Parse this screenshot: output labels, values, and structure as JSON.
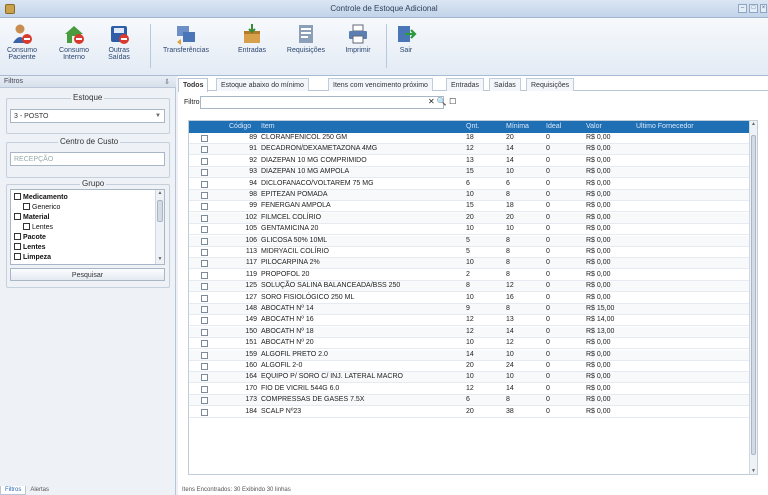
{
  "window": {
    "title": "Controle de Estoque Adicional"
  },
  "ribbon": {
    "buttons": [
      {
        "label": "Consumo\nPaciente",
        "icon": "patient-consumption-icon"
      },
      {
        "label": "Consumo\nInterno",
        "icon": "home-consumption-icon"
      },
      {
        "label": "Outras\nSaídas",
        "icon": "other-exits-icon"
      },
      {
        "label": "Transferências",
        "icon": "transfer-icon"
      },
      {
        "label": "Entradas",
        "icon": "entries-icon"
      },
      {
        "label": "Requisições",
        "icon": "requisitions-icon"
      },
      {
        "label": "Imprimir",
        "icon": "printer-icon"
      },
      {
        "label": "Sair",
        "icon": "exit-icon"
      }
    ]
  },
  "sidebar": {
    "header": "Filtros",
    "estoque": {
      "label": "Estoque",
      "value": "3 - POSTO"
    },
    "centro_custo": {
      "label": "Centro de Custo",
      "placeholder": "RECEPÇÃO"
    },
    "grupo": {
      "label": "Grupo",
      "items": [
        {
          "label": "Medicamento",
          "level": 0
        },
        {
          "label": "Generico",
          "level": 1
        },
        {
          "label": "Material",
          "level": 0
        },
        {
          "label": "Lentes",
          "level": 1
        },
        {
          "label": "Pacote",
          "level": 0
        },
        {
          "label": "Lentes",
          "level": 0
        },
        {
          "label": "Limpeza",
          "level": 0
        }
      ]
    },
    "search_button": "Pesquisar",
    "bottom_tabs": [
      "Filtros",
      "Alertas"
    ]
  },
  "main": {
    "tabs": [
      "Todos",
      "Estoque abaixo do mínimo",
      "Itens com vencimento próximo",
      "Entradas",
      "Saídas",
      "Requisições"
    ],
    "filter_label": "Filtro:",
    "filter_tools": "✕ 🔍 ☐",
    "columns": [
      "Código",
      "Item",
      "Qnt.",
      "Mínima",
      "Ideal",
      "Valor",
      "Ultimo Fornecedor"
    ],
    "rows": [
      [
        "89",
        "CLORANFENICOL 250 GM",
        "18",
        "20",
        "0",
        "R$ 0,00",
        ""
      ],
      [
        "91",
        "DECADRON/DEXAMETAZONA 4MG",
        "12",
        "14",
        "0",
        "R$ 0,00",
        ""
      ],
      [
        "92",
        "DIAZEPAN 10 MG COMPRIMIDO",
        "13",
        "14",
        "0",
        "R$ 0,00",
        ""
      ],
      [
        "93",
        "DIAZEPAN 10 MG AMPOLA",
        "15",
        "10",
        "0",
        "R$ 0,00",
        ""
      ],
      [
        "94",
        "DICLOFANACO/VOLTAREM 75 MG",
        "6",
        "6",
        "0",
        "R$ 0,00",
        ""
      ],
      [
        "98",
        "EPITEZAN POMADA",
        "10",
        "8",
        "0",
        "R$ 0,00",
        ""
      ],
      [
        "99",
        "FENERGAN AMPOLA",
        "15",
        "18",
        "0",
        "R$ 0,00",
        ""
      ],
      [
        "102",
        "FILMCEL COLÍRIO",
        "20",
        "20",
        "0",
        "R$ 0,00",
        ""
      ],
      [
        "105",
        "GENTAMICINA 20",
        "10",
        "10",
        "0",
        "R$ 0,00",
        ""
      ],
      [
        "106",
        "GLICOSA 50% 10ML",
        "5",
        "8",
        "0",
        "R$ 0,00",
        ""
      ],
      [
        "113",
        "MIDRYACIL COLÍRIO",
        "5",
        "8",
        "0",
        "R$ 0,00",
        ""
      ],
      [
        "117",
        "PILOCARPINA 2%",
        "10",
        "8",
        "0",
        "R$ 0,00",
        ""
      ],
      [
        "119",
        "PROPOFOL 20",
        "2",
        "8",
        "0",
        "R$ 0,00",
        ""
      ],
      [
        "125",
        "SOLUÇÃO SALINA BALANCEADA/BSS 250",
        "8",
        "12",
        "0",
        "R$ 0,00",
        ""
      ],
      [
        "127",
        "SORO FISIOLÓGICO 250 ML",
        "10",
        "16",
        "0",
        "R$ 0,00",
        ""
      ],
      [
        "148",
        "ABOCATH Nº 14",
        "9",
        "8",
        "0",
        "R$ 15,00",
        ""
      ],
      [
        "149",
        "ABOCATH Nº 16",
        "12",
        "13",
        "0",
        "R$ 14,00",
        ""
      ],
      [
        "150",
        "ABOCATH Nº 18",
        "12",
        "14",
        "0",
        "R$ 13,00",
        ""
      ],
      [
        "151",
        "ABOCATH Nº 20",
        "10",
        "12",
        "0",
        "R$ 0,00",
        ""
      ],
      [
        "159",
        "ALGOFIL PRETO 2.0",
        "14",
        "10",
        "0",
        "R$ 0,00",
        ""
      ],
      [
        "160",
        "ALGOFIL 2-0",
        "20",
        "24",
        "0",
        "R$ 0,00",
        ""
      ],
      [
        "164",
        "EQUIPO P/ SORO C/ INJ. LATERAL MACRO",
        "10",
        "10",
        "0",
        "R$ 0,00",
        ""
      ],
      [
        "170",
        "FIO DE VICRIL 544G 6.0",
        "12",
        "14",
        "0",
        "R$ 0,00",
        ""
      ],
      [
        "173",
        "COMPRESSAS DE GASES 7.5X",
        "6",
        "8",
        "0",
        "R$ 0,00",
        ""
      ],
      [
        "184",
        "SCALP Nº23",
        "20",
        "38",
        "0",
        "R$ 0,00",
        ""
      ]
    ]
  },
  "status": {
    "text": "Itens Encontrados: 30  Exibindo 30 linhas"
  },
  "colors": {
    "grid_header": "#1f6fb5",
    "ribbon_text": "#2c4670"
  }
}
